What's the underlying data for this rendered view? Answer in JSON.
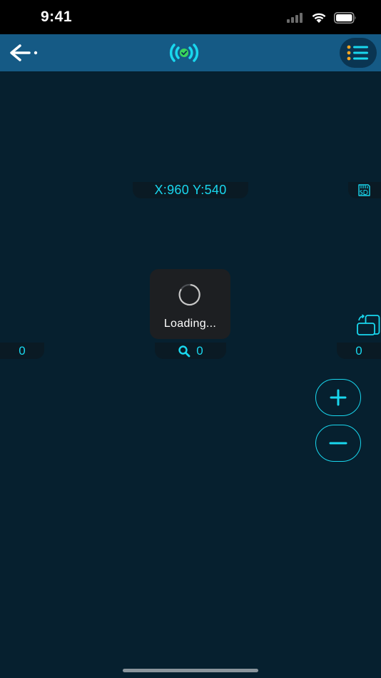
{
  "status_bar": {
    "time": "9:41",
    "icons": [
      "cellular-icon",
      "wifi-icon",
      "battery-icon"
    ]
  },
  "nav": {
    "back_icon": "arrow-left-icon",
    "center_icon": "signal-broadcast-icon",
    "menu_icon": "list-menu-icon"
  },
  "coordinates": {
    "label": "X:960 Y:540"
  },
  "counters": {
    "left": "0",
    "center": "0",
    "right": "0"
  },
  "loading": {
    "text": "Loading..."
  },
  "controls": {
    "sd_icon": "sd-card-icon",
    "rotate_icon": "rotate-device-icon",
    "zoom_in_icon": "plus-icon",
    "zoom_out_icon": "minus-icon"
  },
  "colors": {
    "accent": "#19d7ee",
    "background": "#06202f",
    "nav_bar": "#155a85",
    "menu_dot": "#f5a623",
    "connected": "#3ad65c"
  }
}
